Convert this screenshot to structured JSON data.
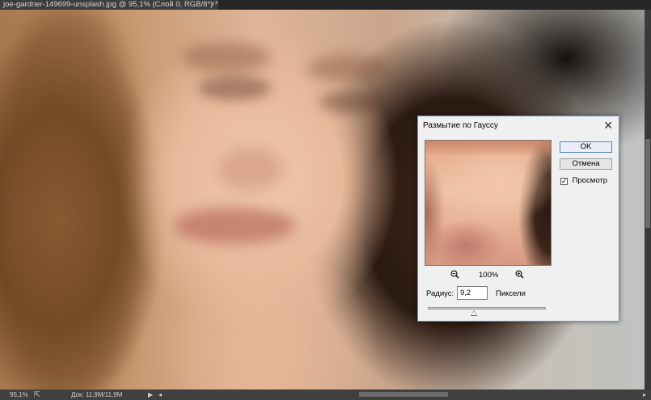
{
  "document_tab": {
    "title": "joe-gardner-149699-unsplash.jpg @ 95,1% (Слой 0, RGB/8*) *",
    "close_glyph": "×"
  },
  "status_bar": {
    "zoom": "95,1%",
    "doc_info": "Док: 11,9M/11,9M",
    "export_icon": "export-icon",
    "menu_arrow_icon": "play-icon"
  },
  "dialog": {
    "title": "Размытие по Гауссу",
    "close_glyph": "✕",
    "ok_label": "OK",
    "cancel_label": "Отмена",
    "preview_label": "Просмотр",
    "preview_checked": true,
    "zoom_value": "100%",
    "radius_label": "Радиус:",
    "radius_value": "9,2",
    "radius_unit": "Пиксели",
    "slider_position": 0.39
  },
  "colors": {
    "dialog_border": "#6b8fc4",
    "ok_border": "#5a7fc0",
    "workspace": "#3a3a3a"
  }
}
